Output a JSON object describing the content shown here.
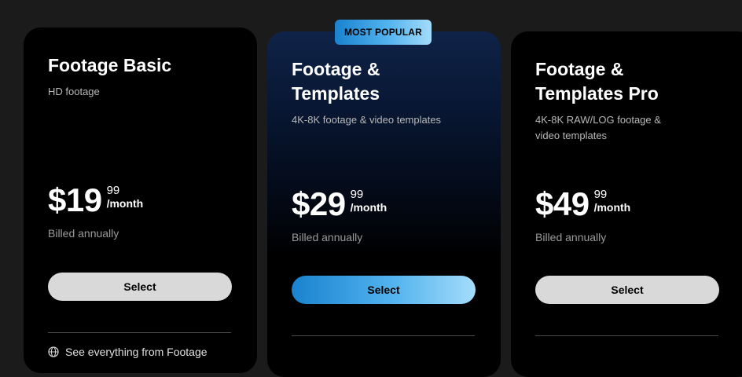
{
  "badge": "MOST POPULAR",
  "plans": [
    {
      "name_line1": "Footage Basic",
      "name_line2": "",
      "desc_line1": "HD footage",
      "desc_line2": "",
      "price_main": "$19",
      "price_cents": "99",
      "price_period": "/month",
      "billed": "Billed annually",
      "cta": "Select",
      "feature_partial": "See everything from Footage"
    },
    {
      "name_line1": "Footage &",
      "name_line2": "Templates",
      "desc_line1": "4K-8K footage & video templates",
      "desc_line2": "",
      "price_main": "$29",
      "price_cents": "99",
      "price_period": "/month",
      "billed": "Billed annually",
      "cta": "Select"
    },
    {
      "name_line1": "Footage &",
      "name_line2": "Templates Pro",
      "desc_line1": "4K-8K RAW/LOG footage &",
      "desc_line2": "video templates",
      "price_main": "$49",
      "price_cents": "99",
      "price_period": "/month",
      "billed": "Billed annually",
      "cta": "Select"
    }
  ],
  "colors": {
    "accent_gradient_start": "#1a82cf",
    "accent_gradient_end": "#a4dcfa",
    "button_neutral": "#d9d9d9"
  }
}
